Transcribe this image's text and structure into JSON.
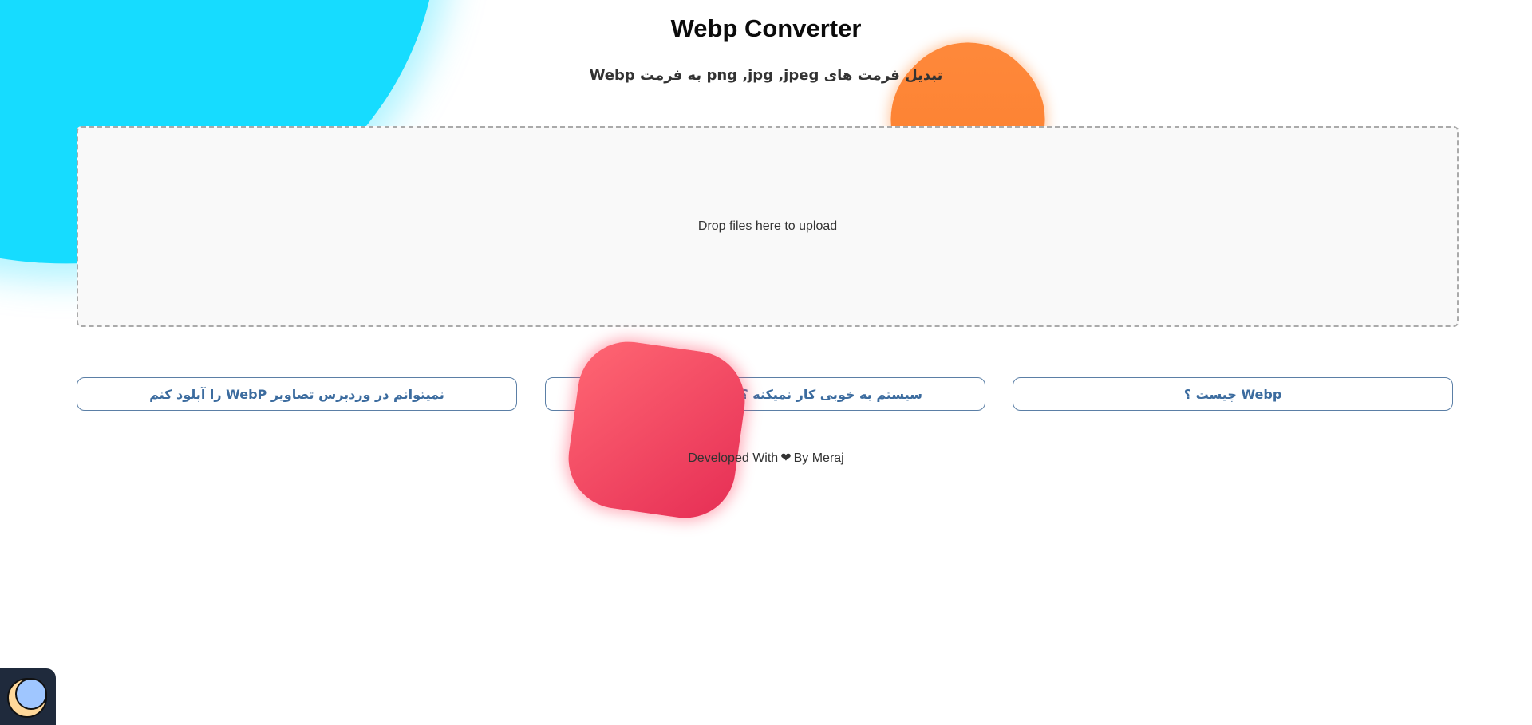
{
  "header": {
    "title": "Webp Converter",
    "subtitle": "تبدیل فرمت های png ,jpg ,jpeg به فرمت Webp"
  },
  "dropzone": {
    "message": "Drop files here to upload"
  },
  "faq_buttons": [
    {
      "label": "نمیتوانم در وردپرس تصاویر WebP را آپلود کنم"
    },
    {
      "label": "سیستم به خوبی کار نمیکنه ؟؟ بریم گزارش کنیم ؟"
    },
    {
      "label": "Webp چیست ؟"
    }
  ],
  "footer": {
    "prefix": "Developed With",
    "heart_icon": "heart-icon",
    "suffix": "By Meraj"
  },
  "theme_toggle": {
    "icon": "moon-icon"
  },
  "colors": {
    "accent_cyan": "#16dcff",
    "accent_orange": "#fb7e2c",
    "accent_red": "#e62e55",
    "link_blue": "#3c6c9f",
    "toggle_bg": "#1f2a3c"
  }
}
